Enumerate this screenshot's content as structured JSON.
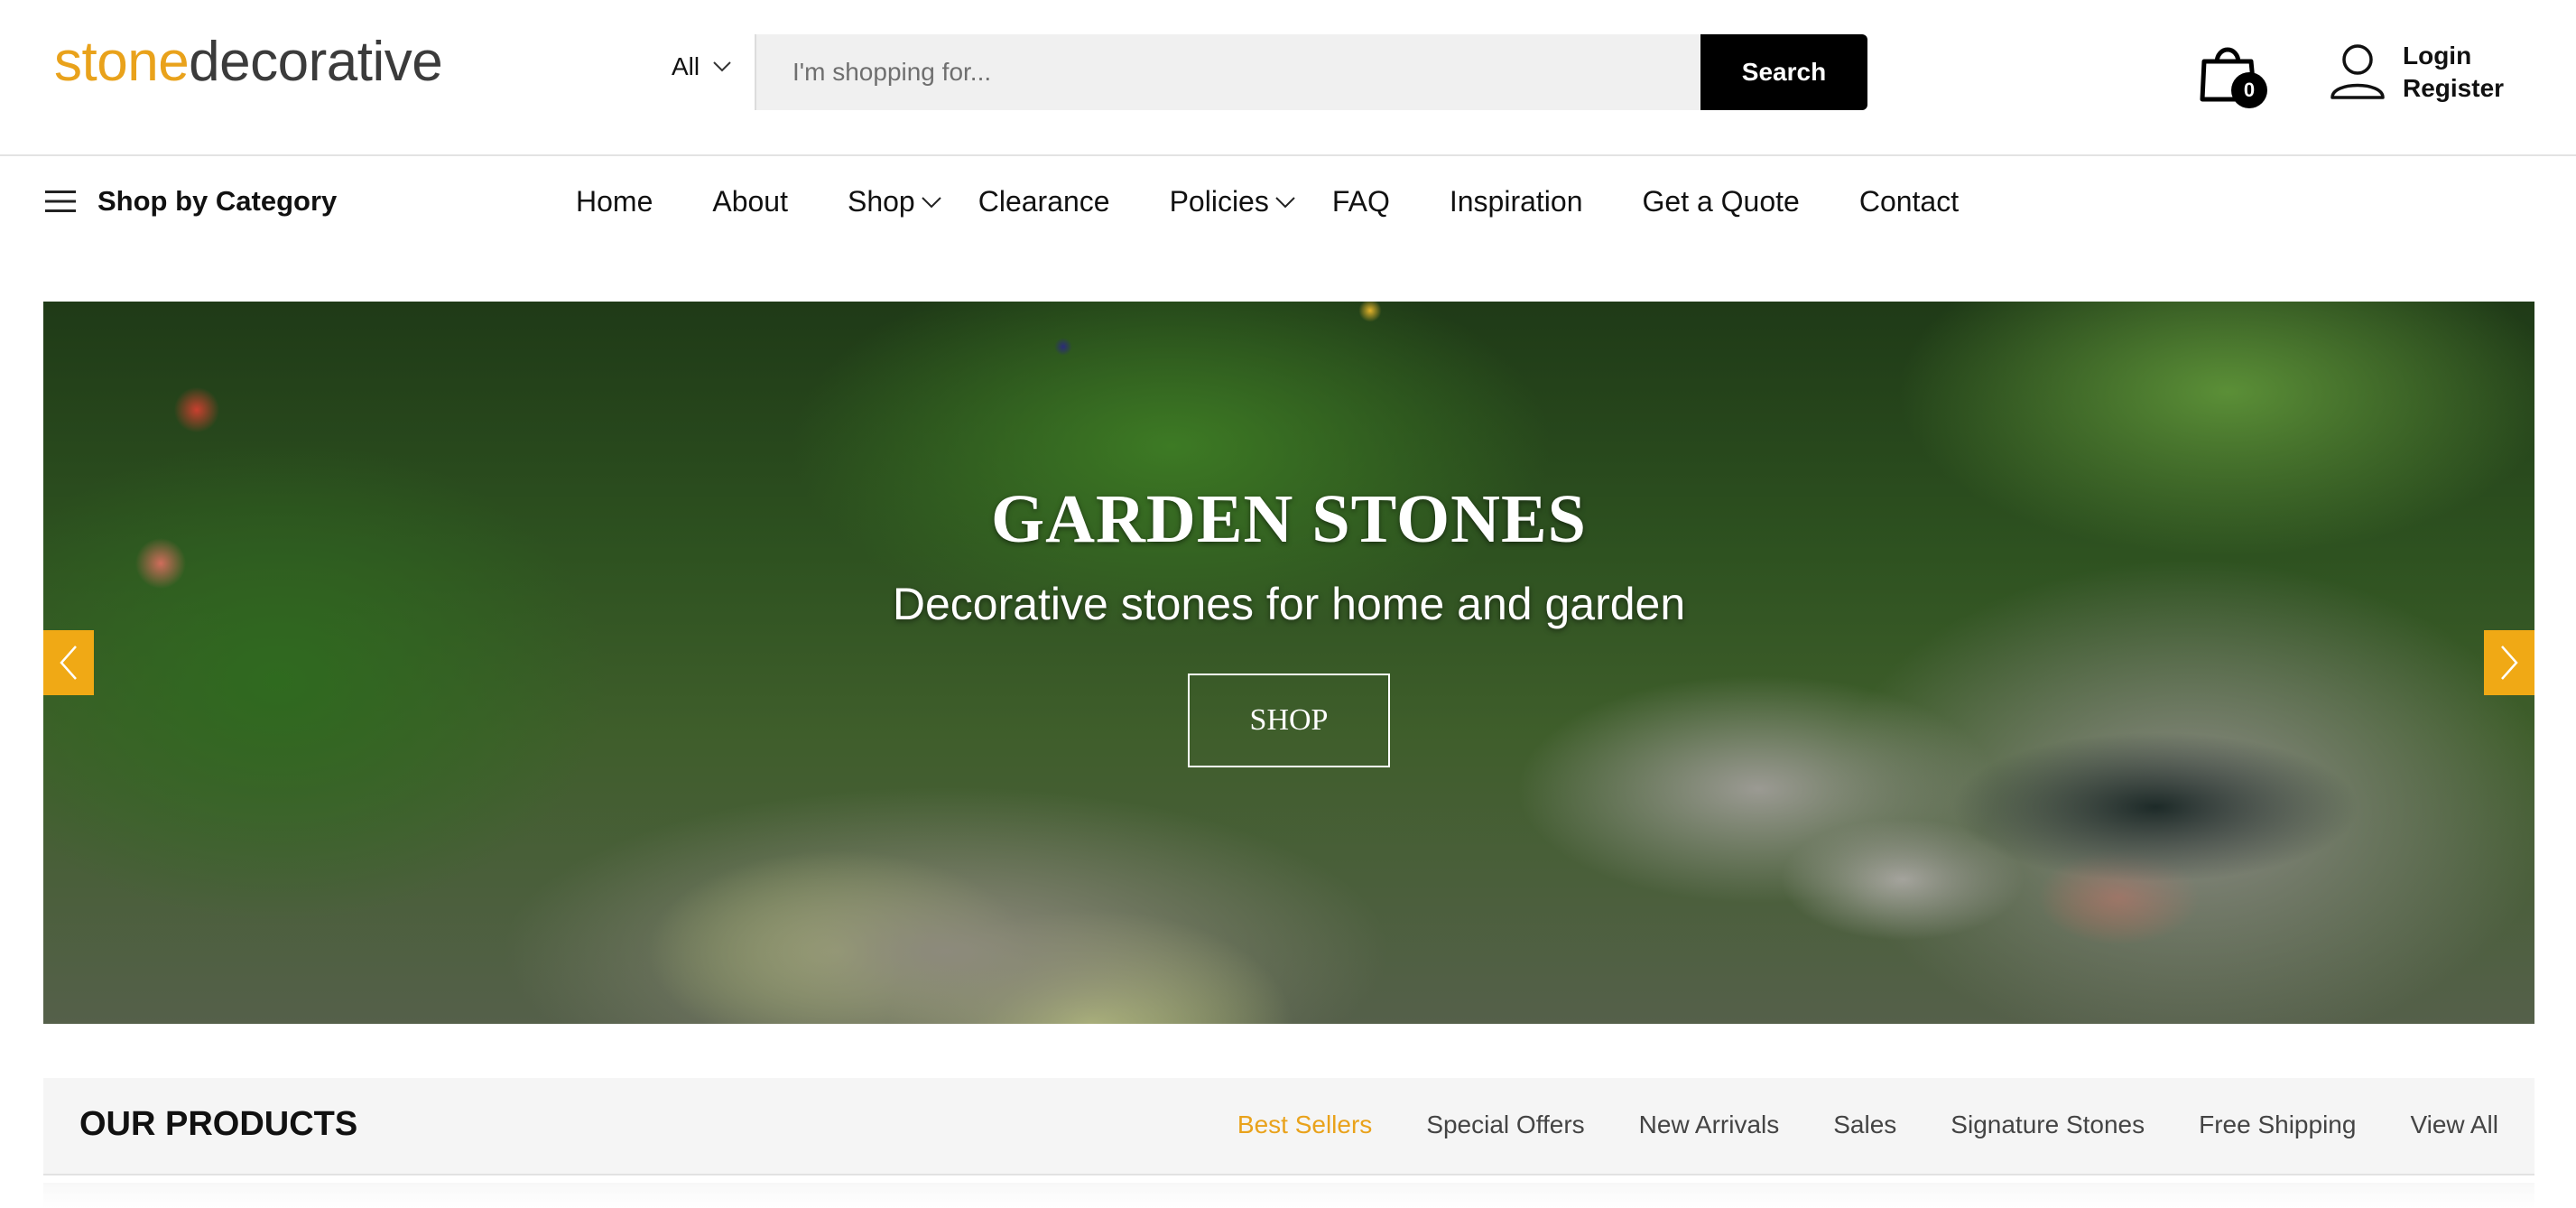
{
  "logo": {
    "part1": "stone",
    "part2": "decorative"
  },
  "search": {
    "category_label": "All",
    "placeholder": "I'm shopping for...",
    "button_label": "Search"
  },
  "cart": {
    "count": "0"
  },
  "account": {
    "login": "Login",
    "register": "Register"
  },
  "nav": {
    "shop_by_category": "Shop by Category",
    "items": [
      {
        "label": "Home"
      },
      {
        "label": "About"
      },
      {
        "label": "Shop"
      },
      {
        "label": "Clearance"
      },
      {
        "label": "Policies"
      },
      {
        "label": "FAQ"
      },
      {
        "label": "Inspiration"
      },
      {
        "label": "Get a Quote"
      },
      {
        "label": "Contact"
      }
    ]
  },
  "hero": {
    "title": "GARDEN STONES",
    "subtitle": "Decorative stones for home and garden",
    "button_label": "SHOP"
  },
  "products": {
    "title": "OUR PRODUCTS",
    "tabs": [
      {
        "label": "Best Sellers"
      },
      {
        "label": "Special Offers"
      },
      {
        "label": "New Arrivals"
      },
      {
        "label": "Sales"
      },
      {
        "label": "Signature Stones"
      },
      {
        "label": "Free Shipping"
      },
      {
        "label": "View All"
      }
    ],
    "active_tab": "Best Sellers"
  },
  "colors": {
    "accent": "#e9a21b",
    "button_dark": "#000000",
    "arrow": "#f0a915"
  }
}
